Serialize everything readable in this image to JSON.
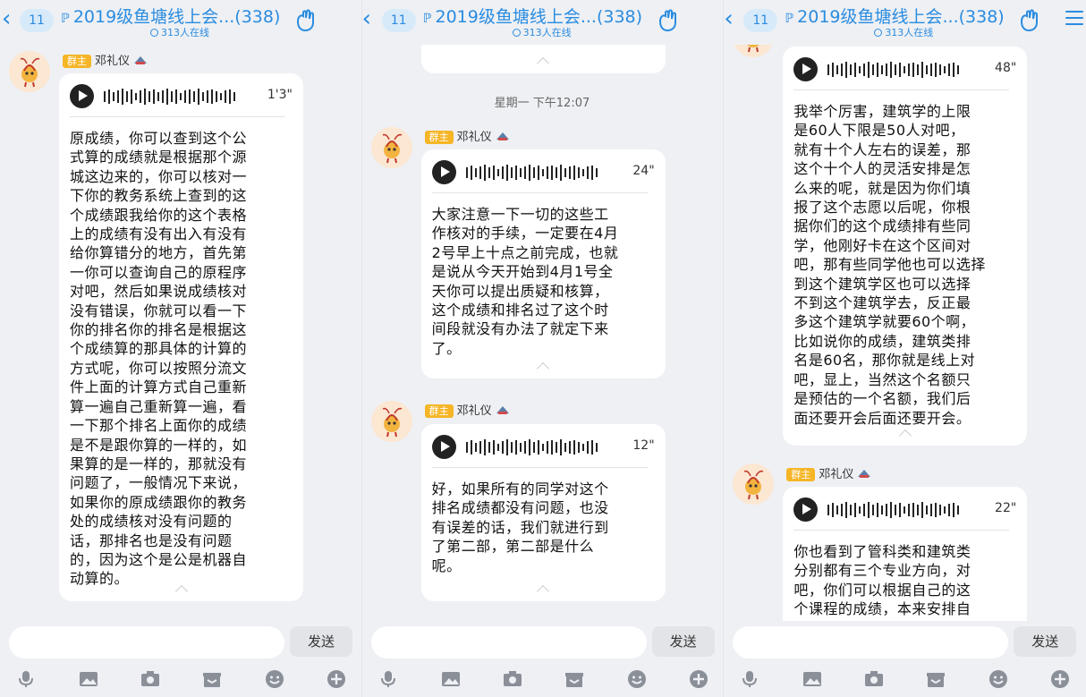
{
  "header": {
    "unread": "11",
    "title": "2019级鱼塘线上会...(338)",
    "online": "313人在线"
  },
  "input": {
    "send_label": "发送"
  },
  "sender": {
    "role": "群主",
    "name": "邓礼仪"
  },
  "icons": [
    "mic-icon",
    "image-icon",
    "camera-icon",
    "gift-icon",
    "emoji-icon",
    "plus-icon"
  ],
  "colors": {
    "accent": "#2a8ce0",
    "role": "#f5b526",
    "bg": "#eef0f4"
  },
  "panels": [
    {
      "messages": [
        {
          "duration": "1'3\"",
          "text": "原成绩，你可以查到这个公\n式算的成绩就是根据那个源\n城这边来的，你可以核对一\n下你的教务系统上查到的这\n个成绩跟我给你的这个表格\n上的成绩有没有出入有没有\n给你算错分的地方，首先第\n一你可以查询自己的原程序\n对吧，然后如果说成绩核对\n没有错误，你就可以看一下\n你的排名你的排名是根据这\n个成绩算的那具体的计算的\n方式呢，你可以按照分流文\n件上面的计算方式自己重新\n算一遍自己重新算一遍，看\n一下那个排名上面你的成绩\n是不是跟你算的一样的，如\n果算的是一样的，那就没有\n问题了，一般情况下来说，\n如果你的原成绩跟你的教务\n处的成绩核对没有问题的\n话，那排名也是没有问题\n的，因为这个是公是机器自\n动算的。"
        }
      ]
    },
    {
      "time": "星期一 下午12:07",
      "messages": [
        {
          "duration": "24\"",
          "text": "大家注意一下一切的这些工\n作核对的手续，一定要在4月\n2号早上十点之前完成，也就\n是说从今天开始到4月1号全\n天你可以提出质疑和核算，\n这个成绩和排名过了这个时\n间段就没有办法了就定下来\n了。"
        },
        {
          "duration": "12\"",
          "text": "好，如果所有的同学对这个\n排名成绩都没有问题，也没\n有误差的话，我们就进行到\n了第二部，第二部是什么\n呢。"
        }
      ]
    },
    {
      "messages": [
        {
          "duration": "48\"",
          "text": "我举个厉害，建筑学的上限\n是60人下限是50人对吧，\n就有十个人左右的误差，那\n这个十个人的灵活安排是怎\n么来的呢，就是因为你们填\n报了这个志愿以后呢，你根\n据你们的这个成绩排有些同\n学，他刚好卡在这个区间对\n吧，那有些同学他也可以选择\n到这个建筑学区也可以选择\n不到这个建筑学去，反正最\n多这个建筑学就要60个啊，\n比如说你的成绩，建筑类排\n名是60名，那你就是线上对\n吧，显上，当然这个名额只\n是预估的一个名额，我们后\n面还要开会后面还要开会。"
        },
        {
          "duration": "22\"",
          "text": "你也看到了管科类和建筑类\n分别都有三个专业方向，对\n吧，你们可以根据自己的这\n个课程的成绩，本来安排自"
        }
      ]
    }
  ]
}
